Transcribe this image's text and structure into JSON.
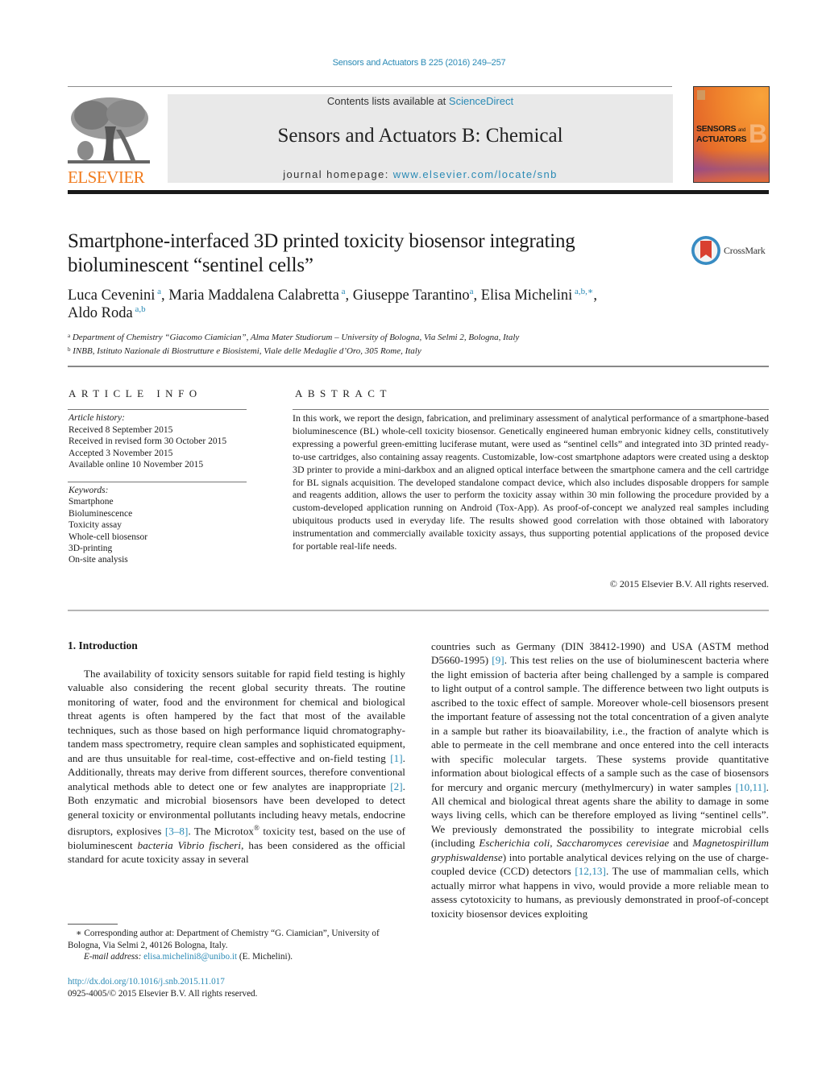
{
  "header": {
    "journal_ref": "Sensors and Actuators B 225 (2016) 249–257",
    "publisher_logo_text": "ELSEVIER",
    "contents_prefix": "Contents lists available at ",
    "contents_link": "ScienceDirect",
    "journal_title": "Sensors and Actuators B: Chemical",
    "homepage_prefix": "journal homepage: ",
    "homepage_link": "www.elsevier.com/locate/snb",
    "cover": {
      "line1": "SENSORS",
      "line1_small": "and",
      "line2": "ACTUATORS",
      "letter": "B"
    },
    "colors": {
      "link": "#2a8ab5",
      "elsevier_orange": "#f07c1f"
    }
  },
  "article": {
    "title_line1": "Smartphone-interfaced 3D printed toxicity biosensor integrating",
    "title_line2": "bioluminescent “sentinel cells”",
    "crossmark_label": "CrossMark",
    "authors": [
      {
        "name": "Luca Cevenini",
        "sup": "a",
        "sep": ", "
      },
      {
        "name": "Maria Maddalena Calabretta",
        "sup": "a",
        "sep": ", "
      },
      {
        "name": "Giuseppe Tarantino",
        "sup": "a",
        "sep": ", "
      },
      {
        "name": "Elisa Michelini",
        "sup": "a,b,∗",
        "sep": ","
      },
      {
        "name": "Aldo Roda",
        "sup": "a,b",
        "sep": ""
      }
    ],
    "affiliations": [
      {
        "mark": "a",
        "text": "Department of Chemistry “Giacomo Ciamician”, Alma Mater Studiorum – University of Bologna, Via Selmi 2, Bologna, Italy"
      },
      {
        "mark": "b",
        "text": "INBB, Istituto Nazionale di Biostrutture e Biosistemi, Viale delle Medaglie d’Oro, 305 Rome, Italy"
      }
    ]
  },
  "article_info": {
    "heading": "ARTICLE INFO",
    "history_label": "Article history:",
    "history": [
      "Received 8 September 2015",
      "Received in revised form 30 October 2015",
      "Accepted 3 November 2015",
      "Available online 10 November 2015"
    ],
    "keywords_label": "Keywords:",
    "keywords": [
      "Smartphone",
      "Bioluminescence",
      "Toxicity assay",
      "Whole-cell biosensor",
      "3D-printing",
      "On-site analysis"
    ]
  },
  "abstract": {
    "heading": "ABSTRACT",
    "text": "In this work, we report the design, fabrication, and preliminary assessment of analytical performance of a smartphone-based bioluminescence (BL) whole-cell toxicity biosensor. Genetically engineered human embryonic kidney cells, constitutively expressing a powerful green-emitting luciferase mutant, were used as “sentinel cells” and integrated into 3D printed ready-to-use cartridges, also containing assay reagents. Customizable, low-cost smartphone adaptors were created using a desktop 3D printer to provide a mini-darkbox and an aligned optical interface between the smartphone camera and the cell cartridge for BL signals acquisition. The developed standalone compact device, which also includes disposable droppers for sample and reagents addition, allows the user to perform the toxicity assay within 30 min following the procedure provided by a custom-developed application running on Android (Tox-App). As proof-of-concept we analyzed real samples including ubiquitous products used in everyday life. The results showed good correlation with those obtained with laboratory instrumentation and commercially available toxicity assays, thus supporting potential applications of the proposed device for portable real-life needs.",
    "copyright": "© 2015 Elsevier B.V. All rights reserved."
  },
  "body": {
    "section_heading": "1.  Introduction",
    "left": {
      "t1": "The availability of toxicity sensors suitable for rapid field testing is highly valuable also considering the recent global security threats. The routine monitoring of water, food and the environment for chemical and biological threat agents is often hampered by the fact that most of the available techniques, such as those based on high performance liquid chromatography-tandem mass spectrometry, require clean samples and sophisticated equipment, and are thus unsuitable for real-time, cost-effective and on-field testing ",
      "r1": "[1]",
      "t2": ". Additionally, threats may derive from different sources, therefore conventional analytical methods able to detect one or few analytes are inappropriate ",
      "r2": "[2]",
      "t3": ". Both enzymatic and microbial biosensors have been developed to detect general toxicity or environmental pollutants including heavy metals, endocrine disruptors, explosives ",
      "r3": "[3–8]",
      "t4": ". The Microtox",
      "reg": "®",
      "t5": " toxicity test, based on the use of bioluminescent ",
      "i1": "bacteria Vibrio fischeri",
      "t6": ", has been considered as the official standard for acute toxicity assay in several"
    },
    "right": {
      "t1": "countries such as Germany (DIN 38412-1990) and USA (ASTM method D5660-1995) ",
      "r1": "[9]",
      "t2": ". This test relies on the use of bioluminescent bacteria where the light emission of bacteria after being challenged by a sample is compared to light output of a control sample. The difference between two light outputs is ascribed to the toxic effect of sample. Moreover whole-cell biosensors present the important feature of assessing not the total concentration of a given analyte in a sample but rather its bioavailability, i.e., the fraction of analyte which is able to permeate in the cell membrane and once entered into the cell interacts with specific molecular targets. These systems provide quantitative information about biological effects of a sample such as the case of biosensors for mercury and organic mercury (methylmercury) in water samples ",
      "r2": "[10,11]",
      "t3": ". All chemical and biological threat agents share the ability to damage in some ways living cells, which can be therefore employed as living “sentinel cells”. We previously demonstrated the possibility to integrate microbial cells (including ",
      "i1": "Escherichia coli",
      "t4": ", ",
      "i2": "Saccharomyces cerevisiae",
      "t5": " and ",
      "i3": "Magnetospirillum gryphiswaldense",
      "t6": ") into portable analytical devices relying on the use of charge-coupled device (CCD) detectors ",
      "r3": "[12,13]",
      "t7": ". The use of mammalian cells, which actually mirror what happens in vivo, would provide a more reliable mean to assess cytotoxicity to humans, as previously demonstrated in proof-of-concept toxicity biosensor devices exploiting"
    }
  },
  "footnotes": {
    "corresponding": "∗  Corresponding author at: Department of Chemistry “G. Ciamician”, University of Bologna, Via Selmi 2, 40126 Bologna, Italy.",
    "email_label": "E-mail address: ",
    "email": "elisa.michelini8@unibo.it",
    "email_suffix": " (E. Michelini).",
    "doi": "http://dx.doi.org/10.1016/j.snb.2015.11.017",
    "issn": "0925-4005/© 2015 Elsevier B.V. All rights reserved."
  }
}
